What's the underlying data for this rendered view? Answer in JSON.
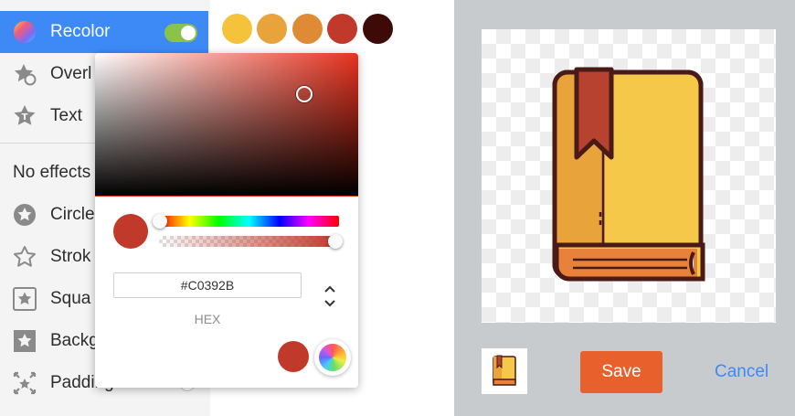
{
  "sidebar": {
    "active_item": {
      "label": "Recolor",
      "icon": "color-wheel-icon",
      "toggle_on": true
    },
    "items": [
      {
        "label": "Overl",
        "icon": "star-overlay-icon"
      },
      {
        "label": "Text",
        "icon": "text-star-icon"
      }
    ],
    "section_label": "No effects",
    "effects": [
      {
        "label": "Circle",
        "icon": "star-circle-icon"
      },
      {
        "label": "Strok",
        "icon": "star-outline-icon"
      },
      {
        "label": "Squa",
        "icon": "star-square-icon"
      },
      {
        "label": "Backg",
        "icon": "star-background-icon"
      },
      {
        "label": "Padding",
        "icon": "padding-arrows-icon"
      }
    ]
  },
  "swatches": [
    "#f5c33b",
    "#e8a33a",
    "#df8a35",
    "#c0392b",
    "#3d0a08"
  ],
  "picker": {
    "hex_value": "#C0392B",
    "mode_label": "HEX",
    "current_color": "#c0392b",
    "hue_position": 0.0,
    "alpha_position": 1.0,
    "saturation": 0.85,
    "brightness": 0.77
  },
  "preview": {
    "image_icon": "book-icon",
    "save_label": "Save",
    "cancel_label": "Cancel"
  }
}
